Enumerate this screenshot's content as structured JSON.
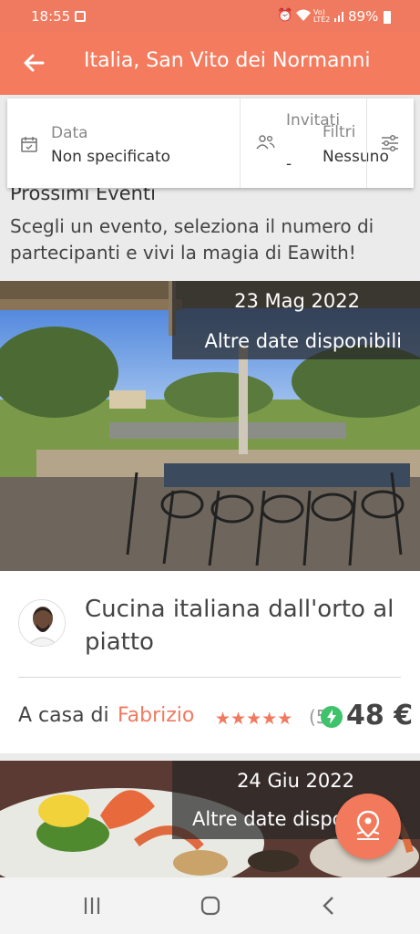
{
  "status_bar": {
    "time": "18:55",
    "volte_top": "Vo)",
    "volte_bottom": "LTE2",
    "battery": "89%"
  },
  "app_bar": {
    "title": "Italia, San Vito dei Normanni",
    "back_icon": "arrow-left-icon"
  },
  "filters": {
    "data_label": "Data",
    "data_value": "Non specificato",
    "invitati_label": "Invitati",
    "invitati_value": "-",
    "filtri_label": "Filtri",
    "filtri_value": "Nessuno"
  },
  "intro": {
    "heading": "Prossimi Eventi",
    "description": "Scegli un evento, seleziona il numero di partecipanti e vivi la magia di Eawith!"
  },
  "events": [
    {
      "date": "23 Mag 2022",
      "more_dates": "Altre date disponibili",
      "title": "Cucina italiana dall'orto al piatto",
      "host_prefix": "A casa di",
      "host_name": "Fabrizio",
      "stars": "★★★★★",
      "reviews": "(5",
      "price": "48 €"
    },
    {
      "date": "24 Giu 2022",
      "more_dates": "Altre date disponibili"
    }
  ],
  "colors": {
    "accent": "#f57b5e",
    "instant_book": "#3ec26a"
  }
}
